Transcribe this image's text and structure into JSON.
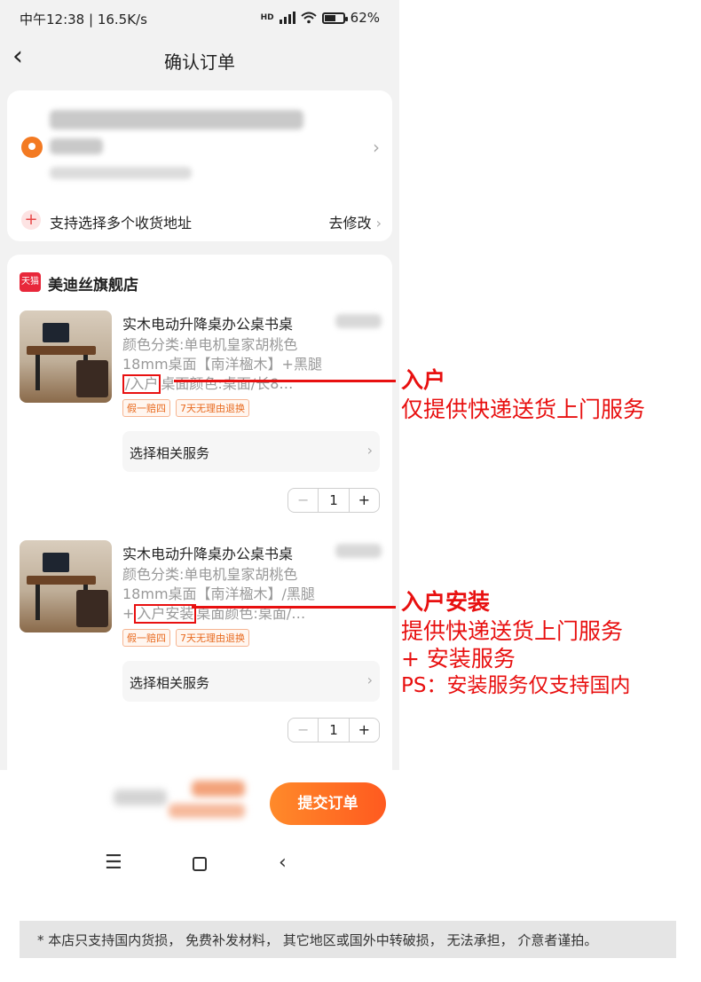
{
  "statusbar": {
    "time_info": "中午12:38 | 16.5K/s",
    "battery": "62%",
    "battery_level": 0.62
  },
  "nav": {
    "back_icon": "chevron-left-icon",
    "title": "确认订单"
  },
  "address": {
    "multi_label": "支持选择多个收货地址",
    "modify_label": "去修改"
  },
  "shop": {
    "logo_text": "天猫",
    "name": "美迪丝旗舰店",
    "items": [
      {
        "title": "实木电动升降桌办公桌书桌",
        "spec_before": "颜色分类:单电机皇家胡桃色18mm桌面【南洋楹木】+黑腿",
        "spec_highlight": "/入户",
        "spec_after": "桌面颜色:桌面/长8…",
        "badges": [
          "假一赔四",
          "7天无理由退换"
        ],
        "service_label": "选择相关服务",
        "quantity": "1"
      },
      {
        "title": "实木电动升降桌办公桌书桌",
        "spec_before": "颜色分类:单电机皇家胡桃色18mm桌面【南洋楹木】/黑腿+",
        "spec_highlight": "入户安装",
        "spec_after": "桌面颜色:桌面/…",
        "badges": [
          "假一赔四",
          "7天无理由退换"
        ],
        "service_label": "选择相关服务",
        "quantity": "1"
      }
    ]
  },
  "submit_label": "提交订单",
  "annotations": {
    "a1_head": "入户",
    "a1_body": "仅提供快递送货上门服务",
    "a2_head": "入户安装",
    "a2_body1": "提供快递送货上门服务",
    "a2_body2": "+ 安装服务",
    "a2_ps": "PS：安装服务仅支持国内"
  },
  "footer_note": "* 本店只支持国内货损， 免费补发材料， 其它地区或国外中转破损， 无法承担， 介意者谨拍。",
  "colors": {
    "accent_orange": "#ff6a1f",
    "annotation_red": "#e81010",
    "tmall_red": "#e8273a"
  }
}
